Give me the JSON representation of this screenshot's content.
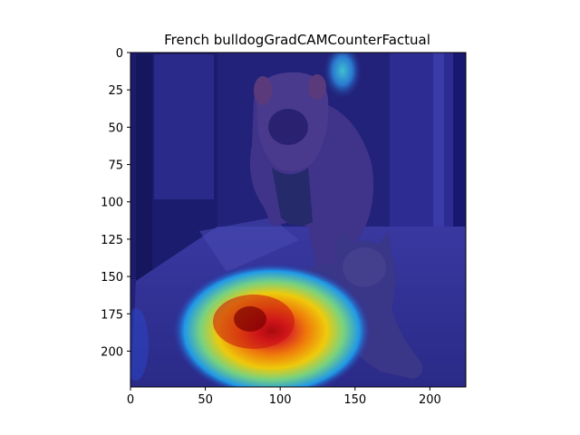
{
  "chart_data": {
    "type": "heatmap",
    "title": "French bulldogGradCAMCounterFactual",
    "xlabel": "",
    "ylabel": "",
    "x_ticks": [
      0,
      50,
      100,
      150,
      200
    ],
    "y_ticks": [
      0,
      25,
      50,
      75,
      100,
      125,
      150,
      175,
      200
    ],
    "xlim": [
      0,
      224
    ],
    "ylim": [
      224,
      0
    ],
    "grid": false,
    "legend": "none",
    "colormap": "jet",
    "image_content": "photo of a bulldog sitting next to a tabby cat",
    "overlay_peak_value": 1.0,
    "overlay_background_value": 0.1,
    "colors": {
      "background_blue": "#22227a",
      "deep_blue": "#181870",
      "peak_red": "#a00000",
      "axis": "#000000"
    }
  }
}
